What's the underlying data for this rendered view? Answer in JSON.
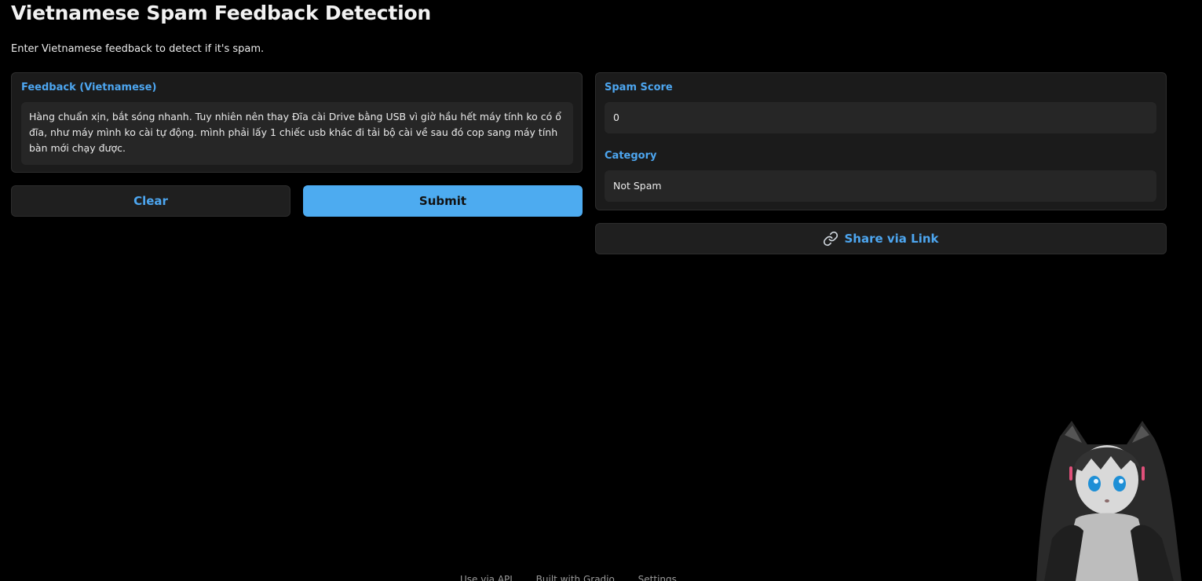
{
  "header": {
    "title": "Vietnamese Spam Feedback Detection",
    "description": "Enter Vietnamese feedback to detect if it's spam."
  },
  "input": {
    "label": "Feedback (Vietnamese)",
    "value": "Hàng chuẩn xịn, bắt sóng nhanh. Tuy nhiên nên thay Đĩa cài Drive bằng USB vì giờ hầu hết máy tính ko có ổ đĩa, như máy mình ko cài tự động. mình phải lấy 1 chiếc usb khác đi tải bộ cài về sau đó cop sang máy tính bàn mới chạy được."
  },
  "buttons": {
    "clear": "Clear",
    "submit": "Submit",
    "share": "Share via Link"
  },
  "output": {
    "score_label": "Spam Score",
    "score_value": "0",
    "category_label": "Category",
    "category_value": "Not Spam"
  },
  "footer": {
    "api": "Use via API",
    "built": "Built with Gradio",
    "settings": "Settings"
  },
  "colors": {
    "accent": "#4da6f0",
    "background": "#000000",
    "panel": "#1b1b1b"
  },
  "icons": {
    "share": "link-icon",
    "mascot": "anime-cat-girl-avatar"
  }
}
